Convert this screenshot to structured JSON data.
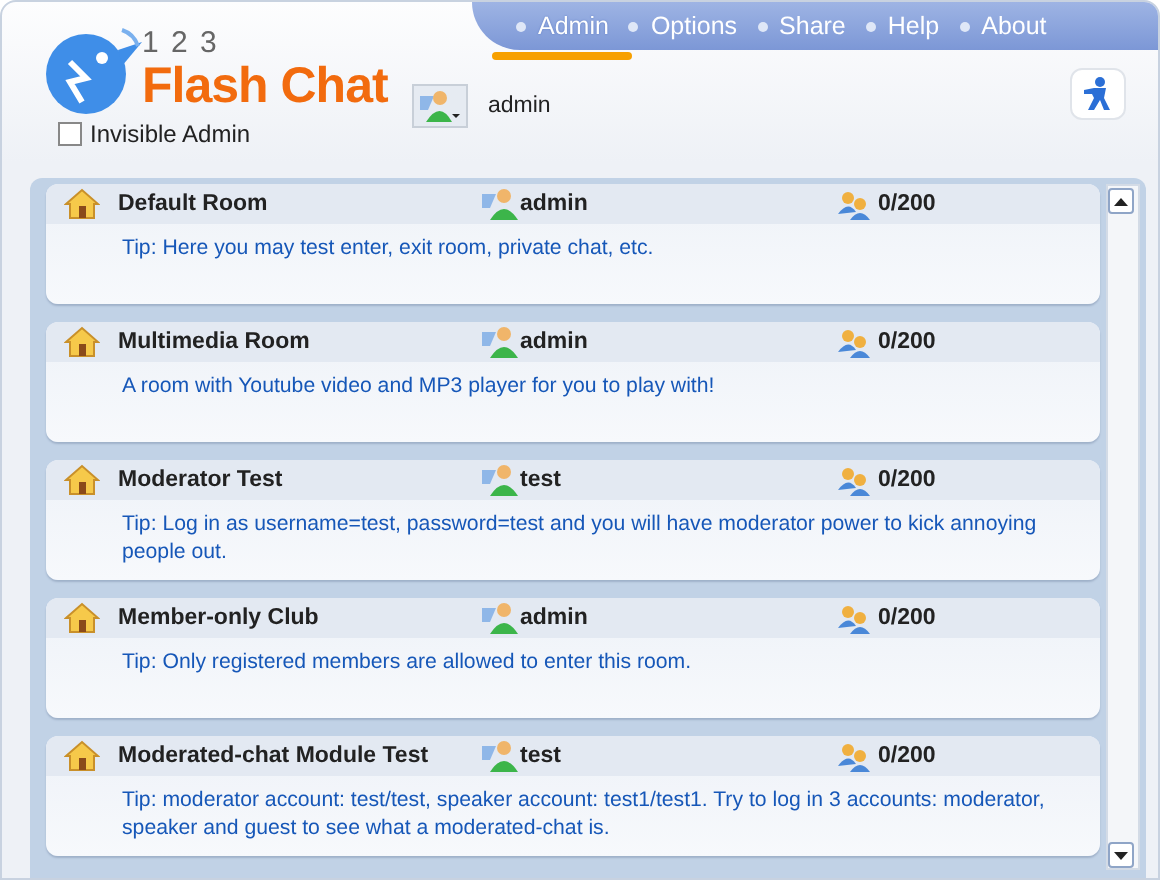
{
  "logo": {
    "numbers": "1 2 3",
    "name": "Flash Chat"
  },
  "nav": [
    {
      "label": "Admin",
      "selected": true
    },
    {
      "label": "Options",
      "selected": false
    },
    {
      "label": "Share",
      "selected": false
    },
    {
      "label": "Help",
      "selected": false
    },
    {
      "label": "About",
      "selected": false
    }
  ],
  "user": {
    "name": "admin"
  },
  "invisible_admin": {
    "label": "Invisible Admin",
    "checked": false
  },
  "rooms": [
    {
      "name": "Default Room",
      "owner": "admin",
      "count": "0/200",
      "description": "Tip: Here you may test enter, exit room, private chat, etc."
    },
    {
      "name": "Multimedia Room",
      "owner": "admin",
      "count": "0/200",
      "description": "A room with Youtube video and MP3 player for you to play with!"
    },
    {
      "name": "Moderator Test",
      "owner": "test",
      "count": "0/200",
      "description": "Tip: Log in as username=test, password=test and you will have moderator power to kick annoying people out."
    },
    {
      "name": "Member-only Club",
      "owner": "admin",
      "count": "0/200",
      "description": "Tip: Only registered members are allowed to enter this room."
    },
    {
      "name": "Moderated-chat Module Test",
      "owner": "test",
      "count": "0/200",
      "description": "Tip: moderator account: test/test, speaker account: test1/test1. Try to log in 3 accounts: moderator, speaker and guest to see what a moderated-chat is."
    }
  ]
}
